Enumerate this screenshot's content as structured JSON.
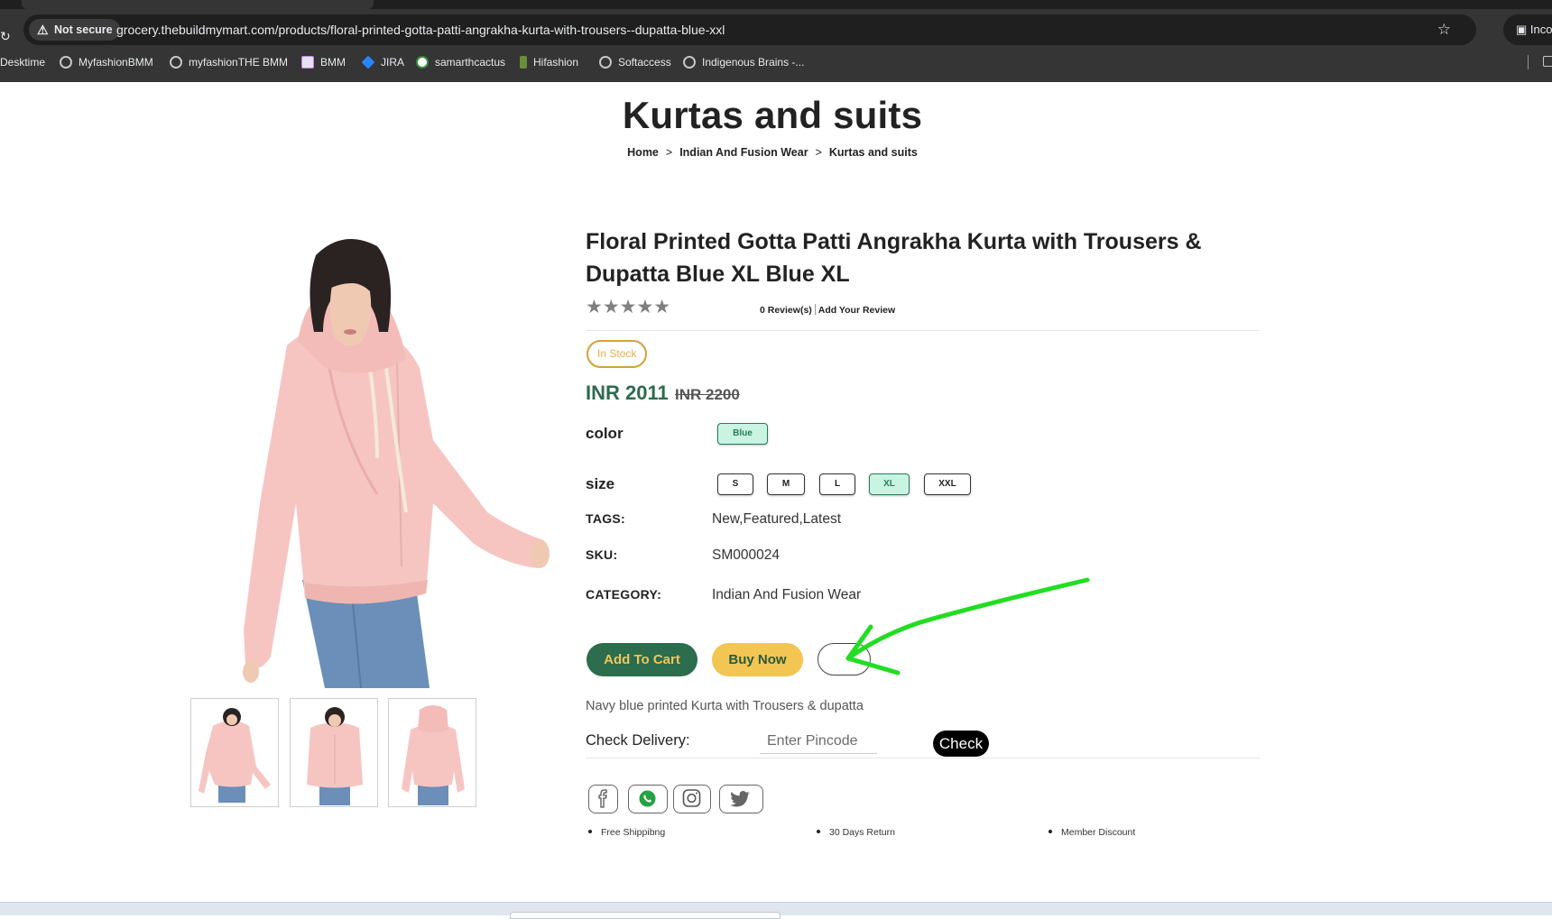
{
  "browser": {
    "security_label": "Not secure",
    "url": "grocery.thebuildmymart.com/products/floral-printed-gotta-patti-angrakha-kurta-with-trousers--dupatta-blue-xxl",
    "profile_label": "Inco",
    "bookmarks": [
      "Desktime",
      "MyfashionBMM",
      "myfashionTHE BMM",
      "BMM",
      "JIRA",
      "samarthcactus",
      "Hifashion",
      "Softaccess",
      "Indigenous Brains -..."
    ]
  },
  "page": {
    "title": "Kurtas and suits",
    "breadcrumb": [
      "Home",
      "Indian And Fusion Wear",
      "Kurtas and suits"
    ],
    "breadcrumb_separator": ">"
  },
  "product": {
    "name": "Floral Printed Gotta Patti Angrakha Kurta with Trousers & Dupatta Blue XL Blue XL",
    "rating_stars": "★★★★★",
    "rating": 0,
    "reviews_label": "0 Review(s)",
    "add_review_label": "Add Your Review",
    "stock_label": "In Stock",
    "price": "INR 2011",
    "old_price": "INR 2200",
    "color_label": "color",
    "colors": [
      "Blue"
    ],
    "selected_color": "Blue",
    "size_label": "size",
    "sizes": [
      "S",
      "M",
      "L",
      "XL",
      "XXL"
    ],
    "selected_size": "XL",
    "tags_key": "TAGS:",
    "tags_value": "New,Featured,Latest",
    "sku_key": "SKU:",
    "sku_value": "SM000024",
    "category_key": "CATEGORY:",
    "category_value": "Indian And Fusion Wear",
    "add_to_cart_label": "Add To Cart",
    "buy_now_label": "Buy Now",
    "description": "Navy blue printed Kurta with Trousers & dupatta",
    "check_delivery_label": "Check Delivery:",
    "pincode_placeholder": "Enter Pincode",
    "check_label": "Check",
    "social": [
      "facebook-icon",
      "whatsapp-icon",
      "instagram-icon",
      "twitter-icon"
    ],
    "perks": [
      "Free Shippibng",
      "30 Days Return",
      "Member Discount"
    ]
  },
  "colors": {
    "accent_green": "#2b6d4d",
    "accent_yellow": "#f3c552",
    "annotation_green": "#22dd22"
  }
}
